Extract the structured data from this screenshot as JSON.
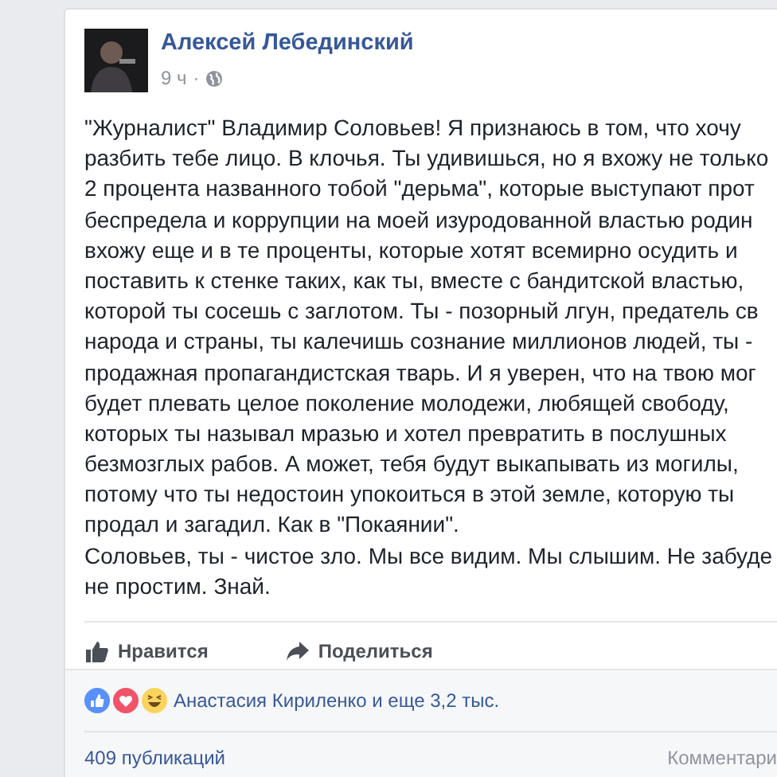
{
  "post": {
    "author": "Алексей Лебединский",
    "time": "9 ч",
    "separator": "·",
    "lines": [
      "\"Журналист\" Владимир Соловьев! Я признаюсь в том, что хочу",
      "разбить тебе лицо. В клочья. Ты удивишься, но я вхожу не только",
      "2 процента названного тобой \"дерьма\", которые выступают прот",
      "беспредела и коррупции на моей изуродованной властью родин",
      "вхожу еще и в те проценты, которые хотят всемирно осудить и",
      "поставить к стенке таких, как ты, вместе с бандитской властью,",
      "которой ты сосешь с заглотом. Ты - позорный лгун, предатель св",
      "народа и страны, ты калечишь сознание миллионов людей, ты -",
      "продажная пропагандистская тварь. И я уверен, что на твою мог",
      "будет плевать целое поколение молодежи, любящей свободу,",
      "которых ты называл мразью и хотел превратить в послушных",
      "безмозглых рабов. А может, тебя будут выкапывать из могилы,",
      "потому что ты недостоин упокоиться в этой земле, которую ты",
      "продал и загадил. Как в \"Покаянии\".",
      "Соловьев, ты - чистое зло. Мы все видим. Мы слышим. Не забуде",
      "не простим. Знай."
    ]
  },
  "actions": [
    {
      "kind": "like",
      "label": "Нравится"
    },
    {
      "kind": "share",
      "label": "Поделиться"
    }
  ],
  "reactions": {
    "icons": [
      {
        "kind": "like"
      },
      {
        "kind": "love"
      },
      {
        "kind": "haha"
      }
    ],
    "summary": "Анастасия Кириленко и еще 3,2 тыс."
  },
  "footer": {
    "shares": "409 публикаций",
    "comments": "Комментари"
  }
}
